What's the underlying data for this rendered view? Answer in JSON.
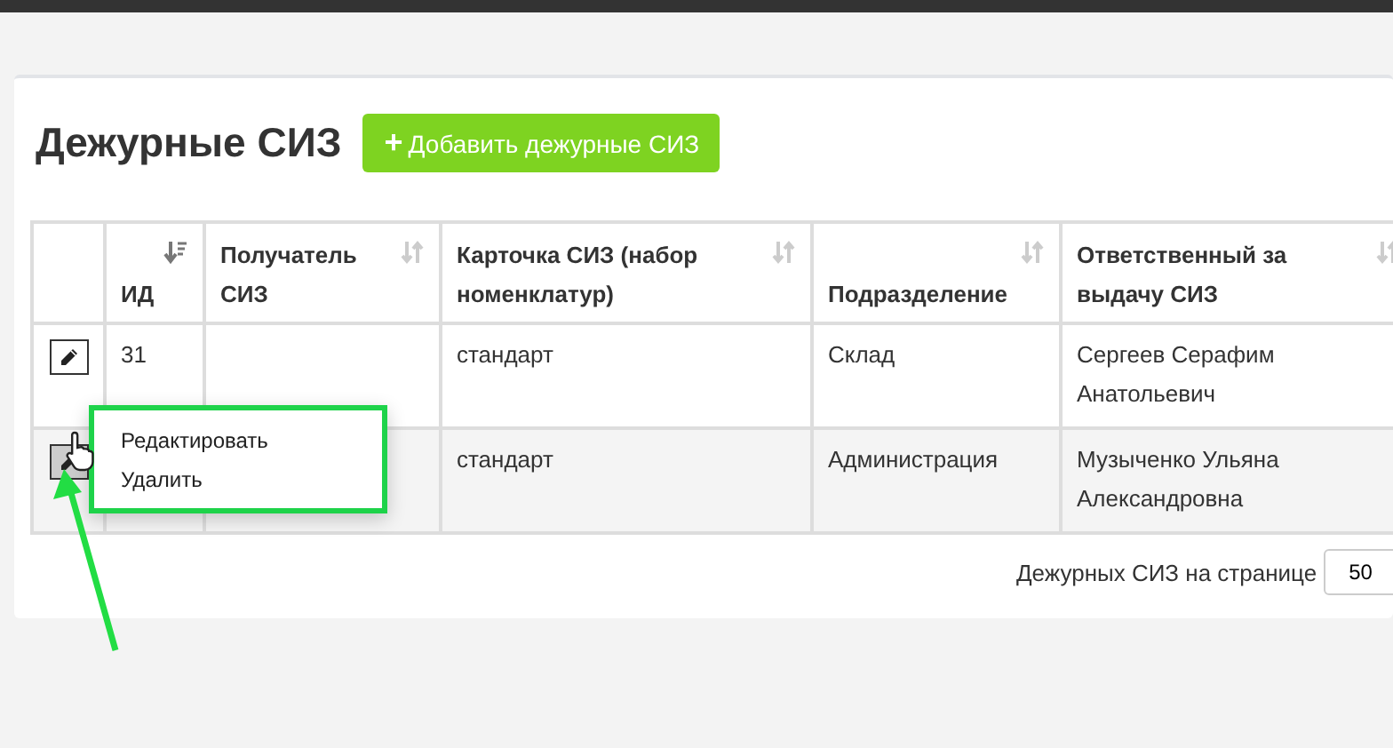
{
  "page_title": "Дежурные СИЗ",
  "add_button": {
    "icon": "+",
    "label": "Добавить дежурные СИЗ"
  },
  "table": {
    "columns": [
      {
        "kind": "actions"
      },
      {
        "label": "ИД",
        "sorted": true
      },
      {
        "label": "Получатель СИЗ",
        "sorted": false
      },
      {
        "label": "Карточка СИЗ (набор номенклатур)",
        "sorted": false
      },
      {
        "label": "Подразделение",
        "sorted": false
      },
      {
        "label": "Ответственный за выдачу СИЗ",
        "sorted": false
      }
    ],
    "rows": [
      {
        "id": "31",
        "card": "стандарт",
        "department": "Склад",
        "responsible": "Сергеев Серафим Анатольевич",
        "selected": false
      },
      {
        "card": "стандарт",
        "department": "Администрация",
        "responsible": "Музыченко Ульяна Александровна",
        "selected": true
      }
    ]
  },
  "row_menu": {
    "items": [
      "Редактировать",
      "Удалить"
    ]
  },
  "pager": {
    "label": "Дежурных СИЗ на странице",
    "value": "50"
  }
}
